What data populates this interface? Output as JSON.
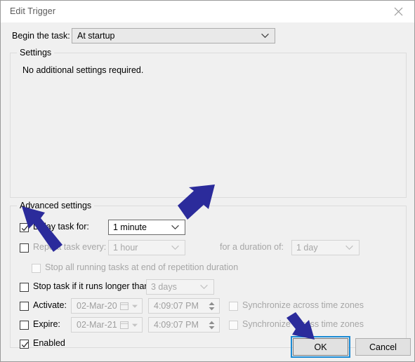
{
  "window": {
    "title": "Edit Trigger",
    "close_icon": "close-icon"
  },
  "begin": {
    "label": "Begin the task:",
    "value": "At startup",
    "arrow_icon": "chevron-down-icon"
  },
  "settings_group": {
    "caption": "Settings",
    "note": "No additional settings required."
  },
  "advanced_group": {
    "caption": "Advanced settings",
    "delay": {
      "label": "Delay task for:",
      "checked": true,
      "value": "1 minute"
    },
    "repeat": {
      "label": "Repeat task every:",
      "checked": false,
      "value": "1 hour",
      "duration_label": "for a duration of:",
      "duration_value": "1 day"
    },
    "stop_all": {
      "label": "Stop all running tasks at end of repetition duration",
      "checked": false
    },
    "stop_longer": {
      "label": "Stop task if it runs longer than:",
      "checked": false,
      "value": "3 days"
    },
    "activate": {
      "label": "Activate:",
      "checked": false,
      "date": "02-Mar-20",
      "time": "4:09:07 PM",
      "sync_label": "Synchronize across time zones",
      "sync_checked": false
    },
    "expire": {
      "label": "Expire:",
      "checked": false,
      "date": "02-Mar-21",
      "time": "4:09:07 PM",
      "sync_label": "Synchronize across time zones",
      "sync_checked": false
    },
    "enabled": {
      "label": "Enabled",
      "checked": true
    }
  },
  "buttons": {
    "ok": "OK",
    "cancel": "Cancel"
  },
  "colors": {
    "annotation_arrow": "#2b2b9b",
    "focus_ring": "#1a8ad4",
    "dialog_background": "#f0f0f0",
    "titlebar_background": "#ffffff",
    "disabled_text": "#a6a6a6"
  }
}
